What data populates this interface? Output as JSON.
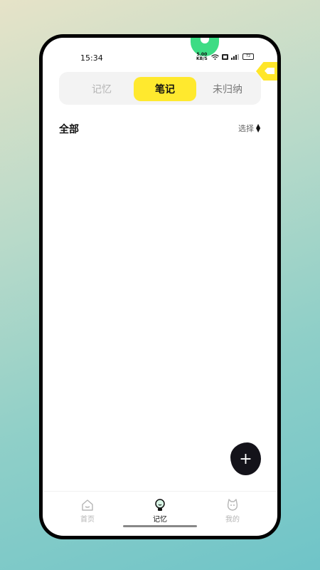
{
  "status_bar": {
    "time": "15:34",
    "net_speed_value": "5.00",
    "net_speed_unit": "KB/S",
    "battery": "72"
  },
  "tabs": [
    {
      "label": "记忆",
      "active": false
    },
    {
      "label": "笔记",
      "active": true
    },
    {
      "label": "未归纳",
      "active": false
    }
  ],
  "list": {
    "title": "全部",
    "select_label": "选择"
  },
  "fab": {
    "icon": "plus-icon",
    "label": "+"
  },
  "bottom_nav": [
    {
      "label": "首页",
      "icon": "home-icon",
      "active": false
    },
    {
      "label": "记忆",
      "icon": "lightbulb-icon",
      "active": true
    },
    {
      "label": "我的",
      "icon": "cat-face-icon",
      "active": false
    }
  ],
  "colors": {
    "accent_yellow": "#ffe92e",
    "fab_dark": "#14131a",
    "notch_green": "#3ddc84"
  }
}
